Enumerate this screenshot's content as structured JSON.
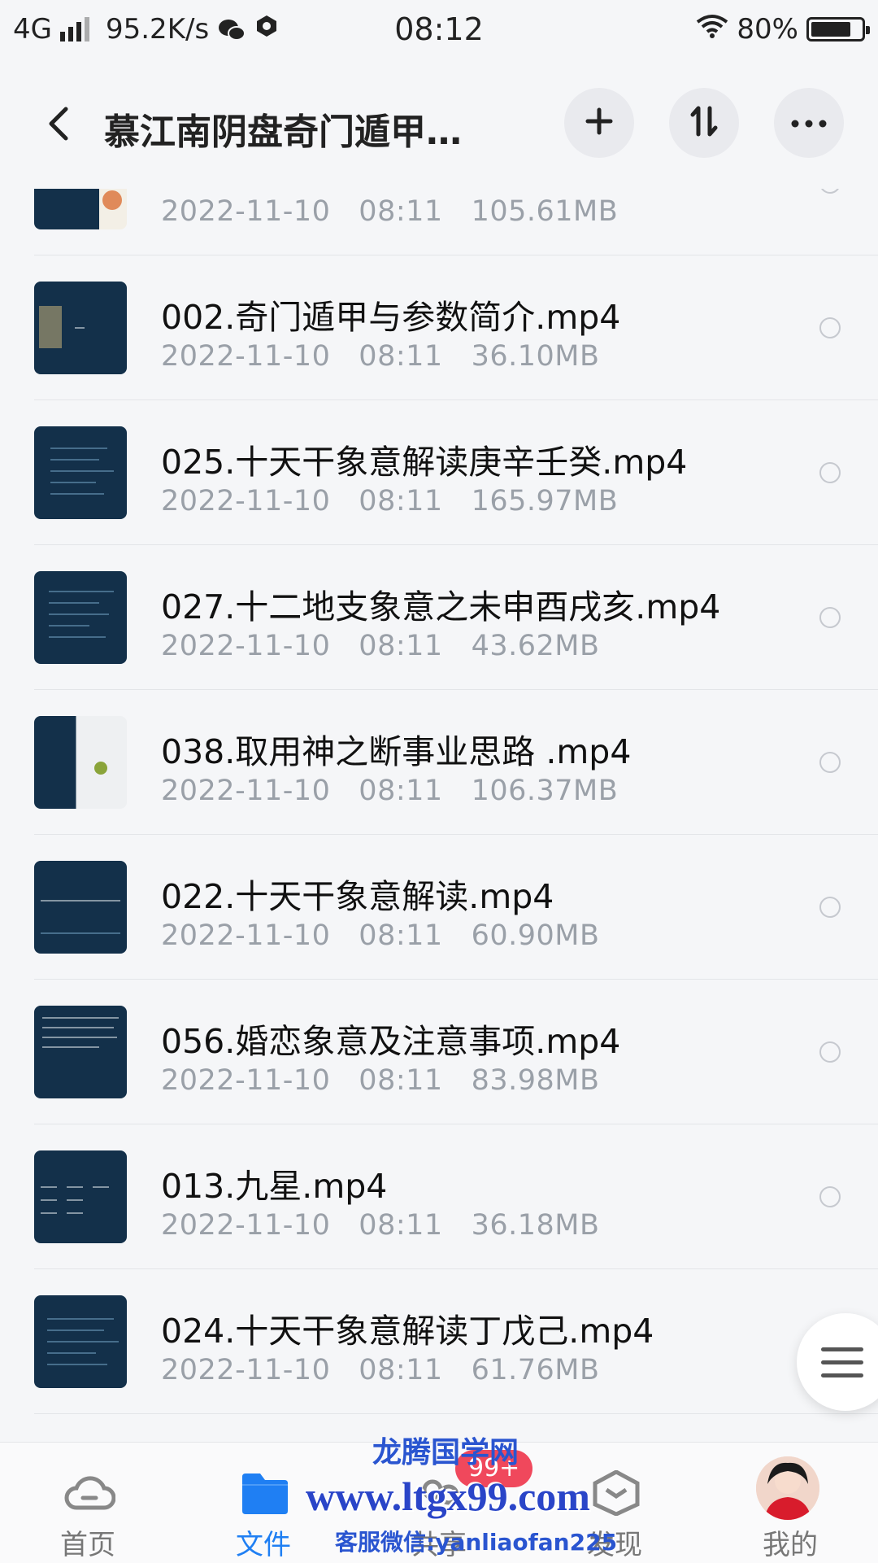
{
  "status_bar": {
    "network": "4G",
    "speed": "95.2K/s",
    "time": "08:12",
    "battery": "80%",
    "battery_level": 0.8
  },
  "header": {
    "title": "慕江南阴盘奇门遁甲…",
    "icons": [
      "back-icon",
      "plus-icon",
      "sort-icon",
      "more-icon"
    ]
  },
  "files": [
    {
      "name": "",
      "date": "2022-11-10",
      "time": "08:11",
      "size": "105.61MB"
    },
    {
      "name": "002.奇门遁甲与参数简介.mp4",
      "date": "2022-11-10",
      "time": "08:11",
      "size": "36.10MB"
    },
    {
      "name": "025.十天干象意解读庚辛壬癸.mp4",
      "date": "2022-11-10",
      "time": "08:11",
      "size": "165.97MB"
    },
    {
      "name": "027.十二地支象意之未申酉戌亥.mp4",
      "date": "2022-11-10",
      "time": "08:11",
      "size": "43.62MB"
    },
    {
      "name": "038.取用神之断事业思路 .mp4",
      "date": "2022-11-10",
      "time": "08:11",
      "size": "106.37MB"
    },
    {
      "name": "022.十天干象意解读.mp4",
      "date": "2022-11-10",
      "time": "08:11",
      "size": "60.90MB"
    },
    {
      "name": "056.婚恋象意及注意事项.mp4",
      "date": "2022-11-10",
      "time": "08:11",
      "size": "83.98MB"
    },
    {
      "name": "013.九星.mp4",
      "date": "2022-11-10",
      "time": "08:11",
      "size": "36.18MB"
    },
    {
      "name": "024.十天干象意解读丁戊己.mp4",
      "date": "2022-11-10",
      "time": "08:11",
      "size": "61.76MB"
    }
  ],
  "tabbar": {
    "tabs": [
      {
        "label": "首页",
        "icon": "cloud-icon"
      },
      {
        "label": "文件",
        "icon": "folder-icon"
      },
      {
        "label": "共享",
        "icon": "share-icon"
      },
      {
        "label": "发现",
        "icon": "discover-icon"
      },
      {
        "label": "我的",
        "icon": "avatar"
      }
    ],
    "active": "文件",
    "badge": "99+"
  },
  "watermark": {
    "line1": "龙腾国学网",
    "line2": "www.ltgx99.com",
    "line3": "客服微信:yanliaofan225"
  },
  "colors": {
    "accent": "#1f7ff3",
    "badge": "#f0485c",
    "thumb_bg": "#13304a",
    "meta_text": "#9aa0a8"
  }
}
